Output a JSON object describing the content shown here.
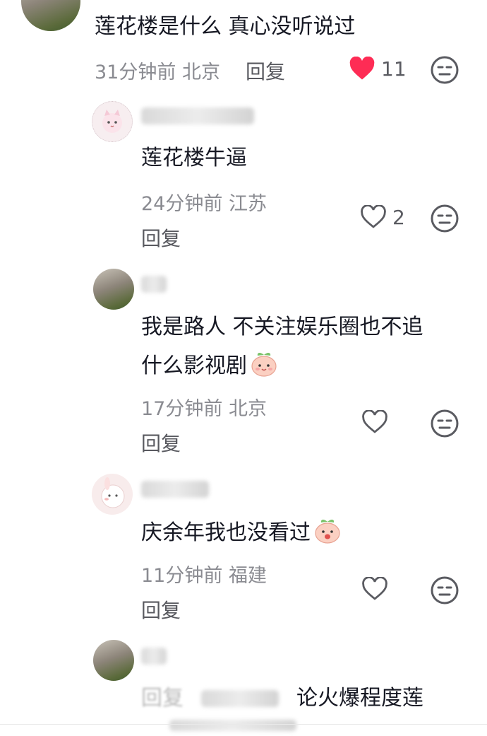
{
  "comments": [
    {
      "text": "莲花楼是什么 真心没听说过",
      "time": "31分钟前",
      "location": "北京",
      "reply_label": "回复",
      "likes": "11",
      "liked": true
    },
    {
      "text": "莲花楼牛逼",
      "time": "24分钟前",
      "location": "江苏",
      "reply_label": "回复",
      "likes": "2",
      "liked": false
    },
    {
      "text_line1": "我是路人 不关注娱乐圈也不追",
      "text_line2": "什么影视剧",
      "time": "17分钟前",
      "location": "北京",
      "reply_label": "回复",
      "likes": "",
      "liked": false
    },
    {
      "text": "庆余年我也没看过",
      "time": "11分钟前",
      "location": "福建",
      "reply_label": "回复",
      "likes": "",
      "liked": false
    },
    {
      "text_partial_prefix": "回复",
      "text_partial_suffix": "论火爆程度莲"
    }
  ],
  "colors": {
    "liked_heart": "#fe2c55",
    "meta_gray": "#8a8b91",
    "text_dark": "#161823"
  },
  "icons": {
    "like": "heart-icon",
    "dislike": "meh-face-icon",
    "emoji": "peach-emoji"
  }
}
